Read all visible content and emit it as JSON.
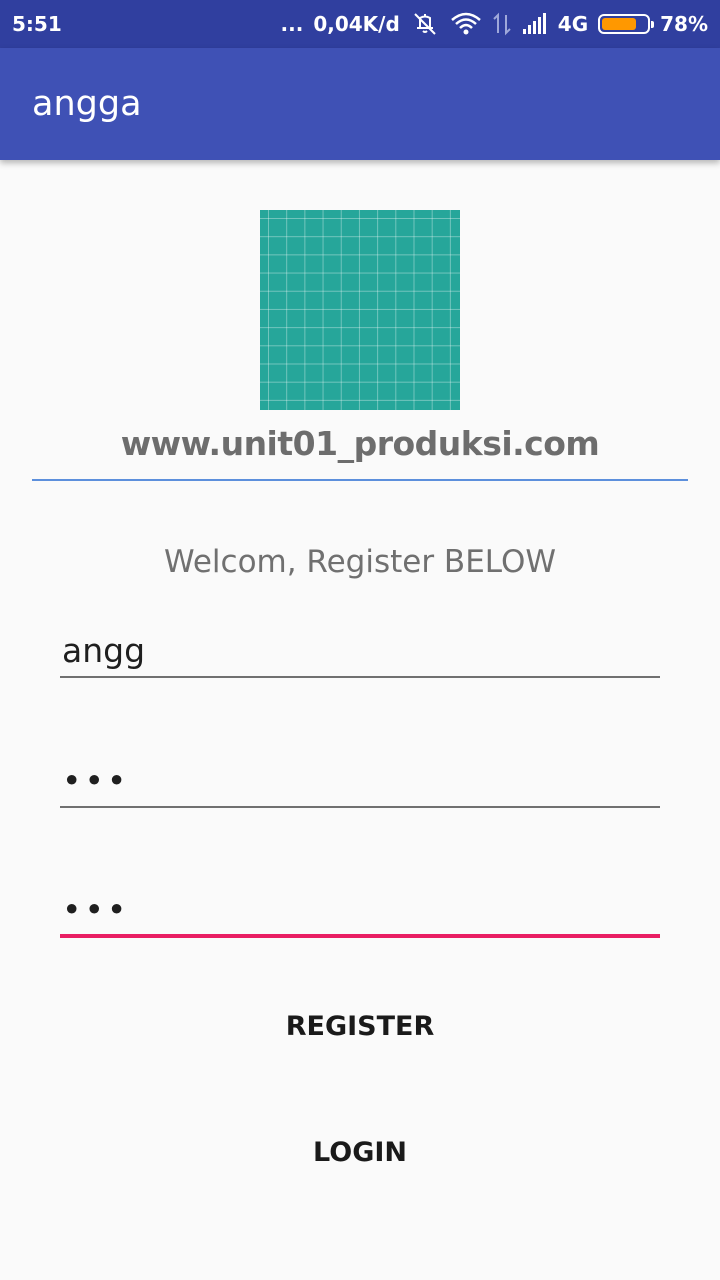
{
  "status_bar": {
    "time": "5:51",
    "more": "...",
    "net_speed": "0,04K/d",
    "network_type": "4G",
    "battery_percent": "78%",
    "battery_level": 0.78,
    "icons": [
      "vibrate-off-icon",
      "wifi-icon",
      "data-arrows-icon",
      "signal-icon",
      "battery-icon"
    ]
  },
  "app_bar": {
    "title": "angga"
  },
  "main": {
    "site_url": "www.unit01_produksi.com",
    "welcome_text": "Welcom, Register BELOW",
    "username_value": "angg",
    "password_value": "•••",
    "confirm_password_value": "•••",
    "register_label": "REGISTER",
    "login_label": "LOGIN"
  },
  "colors": {
    "status_bar": "#303f9f",
    "app_bar": "#3f51b5",
    "logo": "#26a69a",
    "divider": "#5c8fdc",
    "focus_underline": "#e91e63",
    "battery": "#ff9800"
  }
}
